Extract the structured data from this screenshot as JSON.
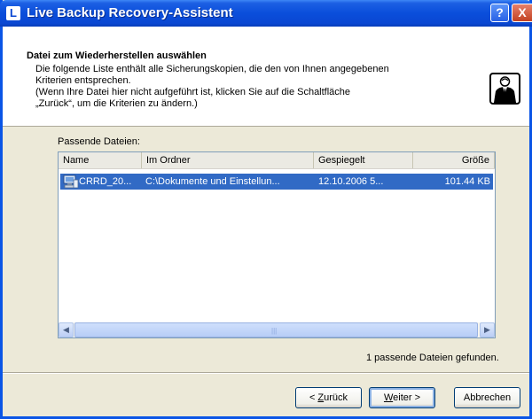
{
  "window": {
    "title": "Live Backup Recovery-Assistent",
    "icon_letter": "L",
    "help_label": "?",
    "close_label": "X"
  },
  "header": {
    "title": "Datei zum Wiederherstellen auswählen",
    "desc_lines": [
      "Die folgende Liste enthält alle Sicherungskopien, die den von Ihnen angegebenen",
      "Kriterien entsprechen.",
      "(Wenn Ihre Datei hier nicht aufgeführt ist, klicken Sie auf die Schaltfläche",
      "„Zurück“, um die Kriterien zu ändern.)"
    ],
    "icon": "wizard-person-icon"
  },
  "list": {
    "label": "Passende Dateien:",
    "columns": [
      "Name",
      "Im Ordner",
      "Gespiegelt",
      "Größe"
    ],
    "rows": [
      {
        "name": "CRRD_20...",
        "folder": "C:\\Dokumente und Einstellun...",
        "mirrored": "12.10.2006 5...",
        "size": "101.44 KB",
        "selected": true,
        "icon": "file-computer-icon"
      }
    ]
  },
  "status_text": "1  passende Dateien gefunden.",
  "buttons": {
    "back": {
      "prefix": "< ",
      "accel": "Z",
      "rest": "urück"
    },
    "next": {
      "accel": "W",
      "rest": "eiter >"
    },
    "cancel": "Abbrechen"
  },
  "colors": {
    "titlebar": "#0A4EDB",
    "selection": "#316AC5",
    "dialog_bg": "#ECE9D8"
  }
}
